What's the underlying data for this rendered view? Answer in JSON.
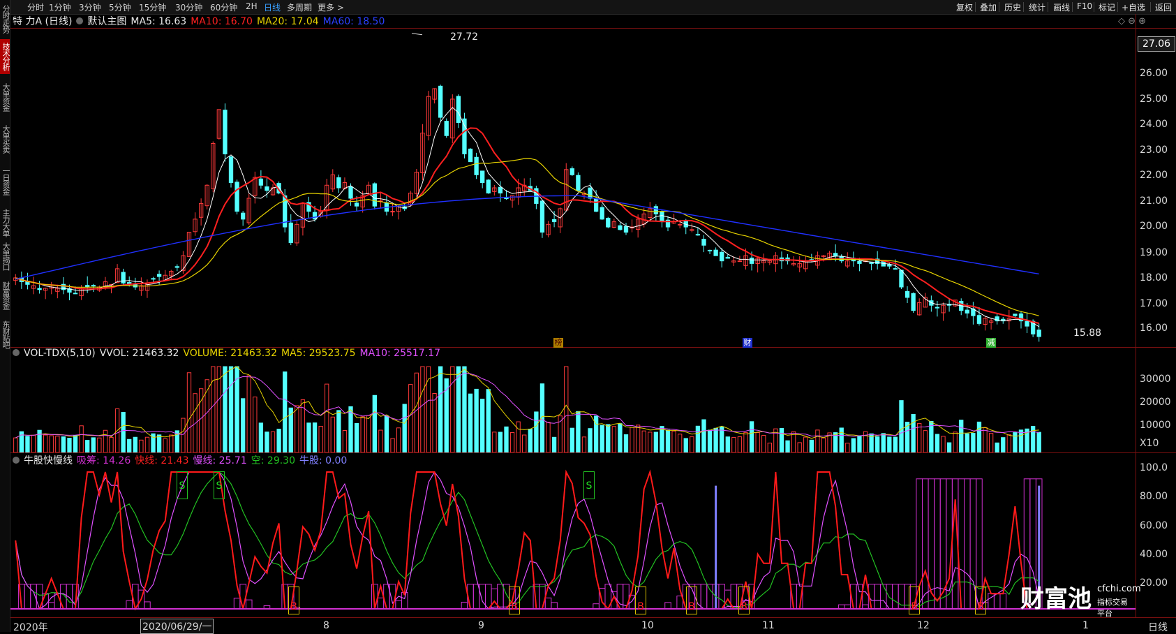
{
  "side_tabs": [
    "分时走势",
    "技术分析",
    "大单资金",
    "大单买卖",
    "一日资金",
    "主力大单",
    "大单揭口",
    "财富资金",
    "东财贴吧"
  ],
  "toolbar": {
    "periods": [
      "分时",
      "1分钟",
      "3分钟",
      "5分钟",
      "15分钟",
      "30分钟",
      "60分钟",
      "2H",
      "日线",
      "多周期",
      "更多 >"
    ],
    "selected_period": "日线",
    "right_buttons": [
      "复权",
      "叠加",
      "历史",
      "统计",
      "画线",
      "F10",
      "标记",
      "+自选",
      "返回"
    ]
  },
  "main_header": {
    "stock": "特 力A (日线)",
    "view": "默认主图",
    "ma5": "MA5: 16.63",
    "ma10": "MA10: 16.70",
    "ma20": "MA20: 17.04",
    "ma60": "MA60: 18.50"
  },
  "price_axis": [
    "27.06",
    "26.00",
    "25.00",
    "24.00",
    "23.00",
    "22.00",
    "21.00",
    "20.00",
    "19.00",
    "18.00",
    "17.00",
    "16.00"
  ],
  "price_annotations": {
    "high": "27.72",
    "low": "15.88"
  },
  "event_markers": [
    "榜",
    "财",
    "减"
  ],
  "vol_header": {
    "name": "VOL-TDX(5,10)",
    "vvol": "VVOL: 21463.32",
    "volume": "VOLUME: 21463.32",
    "ma5": "MA5: 29523.75",
    "ma10": "MA10: 25517.17"
  },
  "vol_axis": [
    "30000",
    "20000",
    "10000",
    "X10"
  ],
  "ind_header": {
    "name": "牛股快慢线",
    "xichou": "吸筹: 14.26",
    "fast": "快线: 21.43",
    "slow": "慢线: 25.71",
    "kong": "空: 29.30",
    "niugu": "牛股: 0.00"
  },
  "ind_axis": [
    "100.0",
    "80.00",
    "60.00",
    "40.00",
    "20.00"
  ],
  "signals": {
    "buy": "B",
    "sell": "S"
  },
  "x_axis": [
    "2020年",
    "2020/06/29/一",
    "8",
    "9",
    "10",
    "11",
    "12",
    "1"
  ],
  "x_axis_right": "日线",
  "logo": {
    "brand": "财富池",
    "url": "cfchi.com",
    "tagline": "指标交易平台"
  },
  "colors": {
    "up": "#ff3a3a",
    "down": "#54ffff",
    "ma5": "#ffffff",
    "ma10": "#ff2020",
    "ma20": "#e6d200",
    "ma60": "#2030ff",
    "fast": "#ff1a1a",
    "slow": "#e050ff",
    "kong": "#22c022",
    "xichou": "#d030d0",
    "niugu": "#8080ff",
    "border": "#7a1010"
  },
  "chart_data": {
    "type": "candlestick",
    "period": "日线",
    "price_ylim": [
      15.7,
      27.9
    ],
    "closes": [
      18.35,
      18.2,
      18.1,
      18.05,
      17.9,
      17.95,
      18.0,
      17.95,
      17.9,
      17.8,
      17.75,
      17.95,
      18.0,
      18.05,
      18.0,
      18.2,
      18.1,
      18.7,
      18.15,
      18.1,
      18.0,
      18.05,
      18.15,
      18.3,
      18.4,
      18.45,
      18.6,
      18.75,
      19.2,
      20.1,
      20.6,
      21.2,
      21.9,
      23.5,
      24.8,
      23.1,
      22.0,
      20.9,
      20.6,
      21.4,
      22.2,
      21.9,
      21.7,
      21.8,
      21.6,
      20.3,
      19.7,
      20.4,
      21.2,
      20.9,
      20.6,
      20.9,
      21.9,
      22.3,
      21.8,
      22.0,
      21.4,
      21.1,
      21.5,
      21.9,
      21.1,
      21.3,
      20.9,
      20.9,
      21.1,
      21.0,
      21.6,
      22.4,
      23.9,
      25.3,
      25.6,
      24.5,
      23.8,
      25.2,
      24.3,
      23.1,
      22.8,
      22.3,
      22.0,
      21.6,
      21.8,
      21.6,
      21.4,
      21.5,
      21.8,
      21.9,
      21.7,
      21.2,
      20.1,
      20.4,
      20.5,
      21.0,
      22.5,
      22.3,
      21.7,
      21.6,
      21.4,
      20.9,
      20.6,
      20.3,
      20.5,
      20.2,
      20.1,
      20.3,
      20.6,
      20.8,
      21.0,
      20.8,
      20.5,
      20.3,
      20.5,
      20.4,
      20.3,
      20.2,
      20.0,
      19.6,
      19.4,
      19.2,
      19.0,
      19.1,
      19.0,
      19.0,
      19.2,
      18.9,
      19.1,
      19.0,
      19.0,
      19.2,
      19.0,
      19.0,
      18.9,
      18.9,
      19.0,
      19.0,
      19.2,
      19.2,
      19.3,
      19.2,
      19.0,
      19.0,
      19.0,
      18.9,
      19.0,
      18.9,
      18.9,
      18.8,
      18.8,
      18.7,
      18.0,
      17.6,
      17.1,
      17.4,
      17.6,
      17.3,
      17.2,
      17.3,
      17.3,
      17.5,
      17.1,
      17.0,
      16.9,
      16.6,
      16.8,
      16.7,
      16.7,
      16.7,
      16.8,
      16.9,
      16.7,
      16.5,
      16.2,
      16.1
    ],
    "ma60_start": 18.3,
    "ma60_peak": 21.5,
    "ma60_end": 18.5,
    "volume_ylim": [
      0,
      37000
    ],
    "indicator_ylim": [
      0,
      100
    ]
  }
}
